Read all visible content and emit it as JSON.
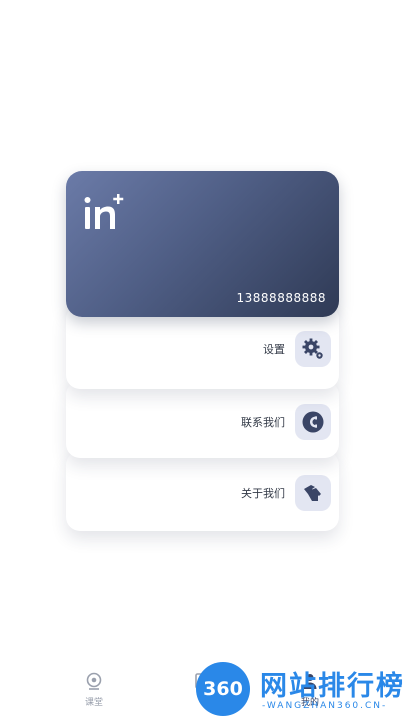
{
  "profile": {
    "phone": "13888888888",
    "logo_icon": "in-plus-logo"
  },
  "menu": [
    {
      "label": "设置",
      "icon": "gear-icon"
    },
    {
      "label": "联系我们",
      "icon": "contact-icon"
    },
    {
      "label": "关于我们",
      "icon": "about-icon"
    }
  ],
  "tabbar": {
    "tabs": [
      {
        "label": "课堂",
        "icon": "classroom-icon"
      },
      {
        "label": "",
        "icon": "book-icon"
      },
      {
        "label": "我的",
        "icon": "user-icon"
      }
    ],
    "active": "我的"
  },
  "watermark": {
    "badge": "360",
    "title": "网站排行榜",
    "subtitle": "-WANGZHAN360.CN-"
  },
  "colors": {
    "card_gradient_start": "#6b7ba8",
    "card_gradient_end": "#2f3a55",
    "icon_tile": "#e3e6f2",
    "icon_color": "#3a4566",
    "watermark_blue": "#2a88e8"
  }
}
